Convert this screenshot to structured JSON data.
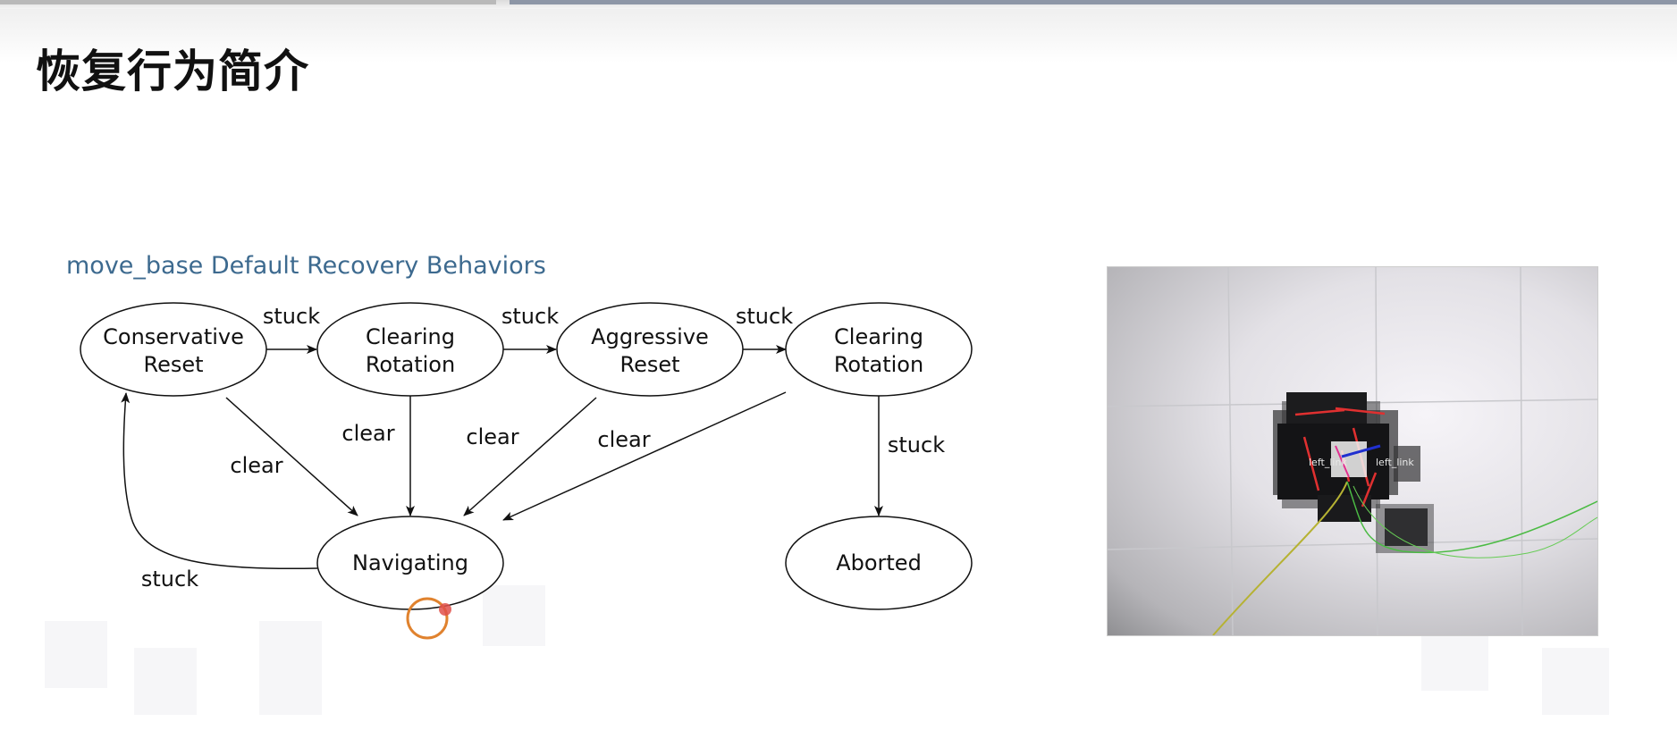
{
  "slide": {
    "title": "恢复行为简介"
  },
  "diagram": {
    "title": "move_base Default Recovery Behaviors",
    "nodes": [
      {
        "id": "conservative_reset",
        "lines": [
          "Conservative",
          "Reset"
        ]
      },
      {
        "id": "clearing_rotation_1",
        "lines": [
          "Clearing",
          "Rotation"
        ]
      },
      {
        "id": "aggressive_reset",
        "lines": [
          "Aggressive",
          "Reset"
        ]
      },
      {
        "id": "clearing_rotation_2",
        "lines": [
          "Clearing",
          "Rotation"
        ]
      },
      {
        "id": "navigating",
        "lines": [
          "Navigating"
        ]
      },
      {
        "id": "aborted",
        "lines": [
          "Aborted"
        ]
      }
    ],
    "edges": [
      {
        "from": "conservative_reset",
        "to": "clearing_rotation_1",
        "label": "stuck"
      },
      {
        "from": "clearing_rotation_1",
        "to": "aggressive_reset",
        "label": "stuck"
      },
      {
        "from": "aggressive_reset",
        "to": "clearing_rotation_2",
        "label": "stuck"
      },
      {
        "from": "conservative_reset",
        "to": "navigating",
        "label": "clear"
      },
      {
        "from": "clearing_rotation_1",
        "to": "navigating",
        "label": "clear"
      },
      {
        "from": "aggressive_reset",
        "to": "navigating",
        "label": "clear"
      },
      {
        "from": "clearing_rotation_2",
        "to": "navigating",
        "label": "clear"
      },
      {
        "from": "clearing_rotation_2",
        "to": "aborted",
        "label": "stuck"
      },
      {
        "from": "navigating",
        "to": "conservative_reset",
        "label": "stuck"
      }
    ]
  },
  "photo": {
    "overlay_labels": [
      "left_link",
      "left_link"
    ]
  },
  "colors": {
    "diagram_title": "#3d6a8f",
    "cursor_ring": "#e0822e",
    "cursor_dot": "#e0504a"
  }
}
